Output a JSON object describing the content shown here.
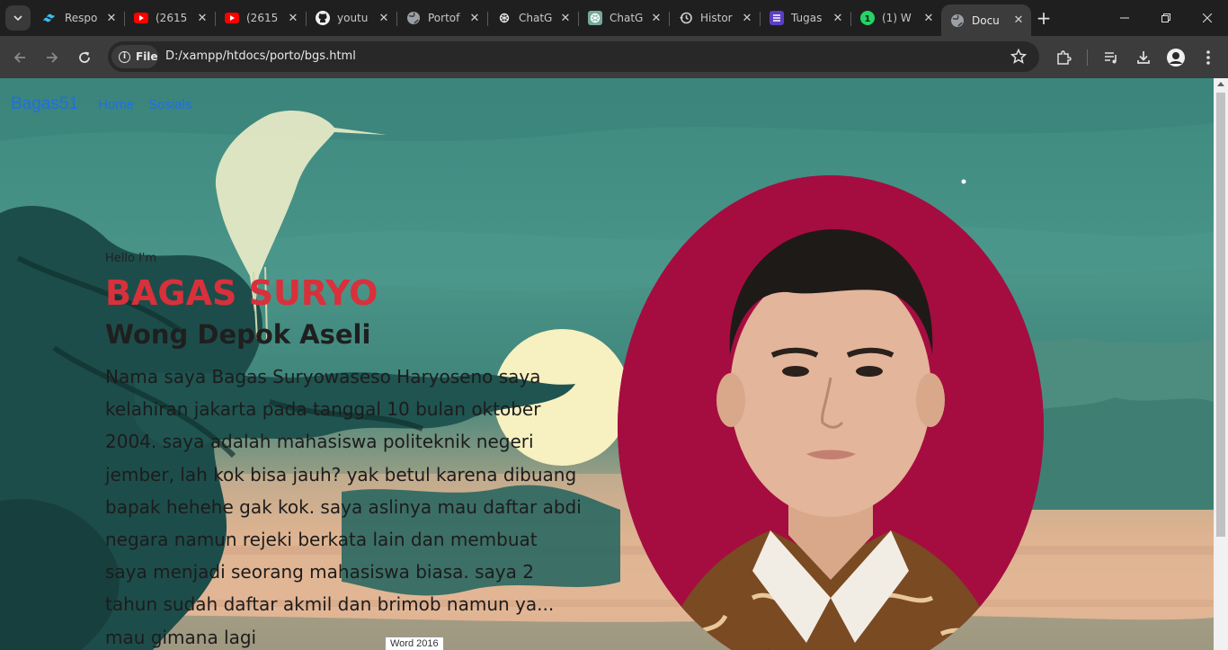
{
  "browser": {
    "tabs": [
      {
        "title": "Respo",
        "icon": "tailwind-icon"
      },
      {
        "title": "(2615",
        "icon": "youtube-icon"
      },
      {
        "title": "(2615",
        "icon": "youtube-icon"
      },
      {
        "title": "youtu",
        "icon": "github-icon"
      },
      {
        "title": "Portof",
        "icon": "globe-icon"
      },
      {
        "title": "ChatG",
        "icon": "chatgpt-icon"
      },
      {
        "title": "ChatG",
        "icon": "chatgpt-icon"
      },
      {
        "title": "Histor",
        "icon": "history-icon"
      },
      {
        "title": "Tugas",
        "icon": "list-icon"
      },
      {
        "title": "(1) W",
        "icon": "whatsapp-icon"
      },
      {
        "title": "Docu",
        "icon": "globe-icon",
        "active": true
      }
    ],
    "address": {
      "scheme_label": "File",
      "url": "D:/xampp/htdocs/porto/bgs.html"
    }
  },
  "site": {
    "nav": {
      "brand": "Bagas51",
      "links": [
        "Home",
        "Sosials"
      ]
    },
    "hero": {
      "greeting": "Hello I'm",
      "name": "BAGAS SURYO",
      "tagline": "Wong Depok Aseli",
      "bio": "Nama saya Bagas Suryowaseso Haryoseno saya kelahiran jakarta pada tanggal 10 bulan oktober 2004. saya adalah mahasiswa politeknik negeri jember, lah kok bisa jauh? yak betul karena dibuang bapak hehehe gak kok. saya aslinya mau daftar abdi negara namun rejeki berkata lain dan membuat saya menjadi seorang mahasiswa biasa. saya 2 tahun sudah daftar akmil dan brimob namun ya... mau gimana lagi"
    },
    "tooltip": "Word 2016"
  },
  "colors": {
    "name_red": "#d9303b",
    "nav_blue": "#1f6fe5",
    "photo_bg": "#a50d40"
  }
}
